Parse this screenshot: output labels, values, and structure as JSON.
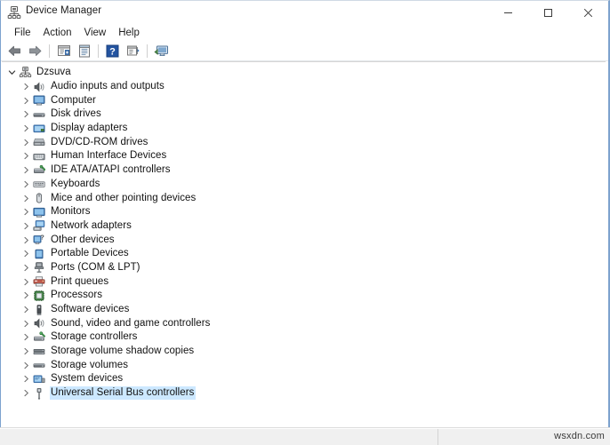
{
  "window": {
    "title": "Device Manager",
    "title_icon": "device-manager-icon",
    "controls": [
      {
        "name": "minimize-button",
        "glyph": "minimize-icon"
      },
      {
        "name": "maximize-button",
        "glyph": "maximize-icon"
      },
      {
        "name": "close-button",
        "glyph": "close-icon"
      }
    ]
  },
  "menubar": {
    "items": [
      {
        "label": "File"
      },
      {
        "label": "Action"
      },
      {
        "label": "View"
      },
      {
        "label": "Help"
      }
    ]
  },
  "toolbar": {
    "buttons": [
      {
        "name": "back-button",
        "icon": "back-arrow-icon"
      },
      {
        "name": "forward-button",
        "icon": "forward-arrow-icon"
      },
      {
        "name": "separator-1",
        "icon": "separator"
      },
      {
        "name": "show-hidden-devices-button",
        "icon": "window-list-icon"
      },
      {
        "name": "properties-button",
        "icon": "properties-icon"
      },
      {
        "name": "separator-2",
        "icon": "separator"
      },
      {
        "name": "help-button",
        "icon": "help-question-icon"
      },
      {
        "name": "update-driver-button",
        "icon": "update-driver-icon"
      },
      {
        "name": "separator-3",
        "icon": "separator"
      },
      {
        "name": "scan-for-hardware-changes-button",
        "icon": "monitor-scan-icon"
      }
    ]
  },
  "tree": {
    "root": {
      "label": "Dzsuva",
      "icon": "computer-node-icon",
      "expanded": true,
      "chevron": "chevron-down-icon"
    },
    "items": [
      {
        "label": "Audio inputs and outputs",
        "icon": "speaker-icon",
        "selected": false
      },
      {
        "label": "Computer",
        "icon": "computer-icon",
        "selected": false
      },
      {
        "label": "Disk drives",
        "icon": "disk-drive-icon",
        "selected": false
      },
      {
        "label": "Display adapters",
        "icon": "display-adapter-icon",
        "selected": false
      },
      {
        "label": "DVD/CD-ROM drives",
        "icon": "dvd-drive-icon",
        "selected": false
      },
      {
        "label": "Human Interface Devices",
        "icon": "hid-icon",
        "selected": false
      },
      {
        "label": "IDE ATA/ATAPI controllers",
        "icon": "ide-controller-icon",
        "selected": false
      },
      {
        "label": "Keyboards",
        "icon": "keyboard-icon",
        "selected": false
      },
      {
        "label": "Mice and other pointing devices",
        "icon": "mouse-icon",
        "selected": false
      },
      {
        "label": "Monitors",
        "icon": "monitor-icon",
        "selected": false
      },
      {
        "label": "Network adapters",
        "icon": "network-adapter-icon",
        "selected": false
      },
      {
        "label": "Other devices",
        "icon": "unknown-device-icon",
        "selected": false
      },
      {
        "label": "Portable Devices",
        "icon": "portable-device-icon",
        "selected": false
      },
      {
        "label": "Ports (COM & LPT)",
        "icon": "port-icon",
        "selected": false
      },
      {
        "label": "Print queues",
        "icon": "printer-icon",
        "selected": false
      },
      {
        "label": "Processors",
        "icon": "processor-icon",
        "selected": false
      },
      {
        "label": "Software devices",
        "icon": "software-device-icon",
        "selected": false
      },
      {
        "label": "Sound, video and game controllers",
        "icon": "sound-controller-icon",
        "selected": false
      },
      {
        "label": "Storage controllers",
        "icon": "storage-controller-icon",
        "selected": false
      },
      {
        "label": "Storage volume shadow copies",
        "icon": "shadow-copy-icon",
        "selected": false
      },
      {
        "label": "Storage volumes",
        "icon": "storage-volume-icon",
        "selected": false
      },
      {
        "label": "System devices",
        "icon": "system-device-icon",
        "selected": false
      },
      {
        "label": "Universal Serial Bus controllers",
        "icon": "usb-controller-icon",
        "selected": true
      }
    ],
    "child_chevron": "chevron-right-icon"
  },
  "statusbar": {
    "left_text": "",
    "right_text": ""
  },
  "watermark": {
    "text": "wsxdn.com"
  },
  "colors": {
    "selection": "#cce8ff",
    "window_border": "#7da2ce",
    "statusbar": "#f0f0f0",
    "help_badge": "#2353a0"
  }
}
